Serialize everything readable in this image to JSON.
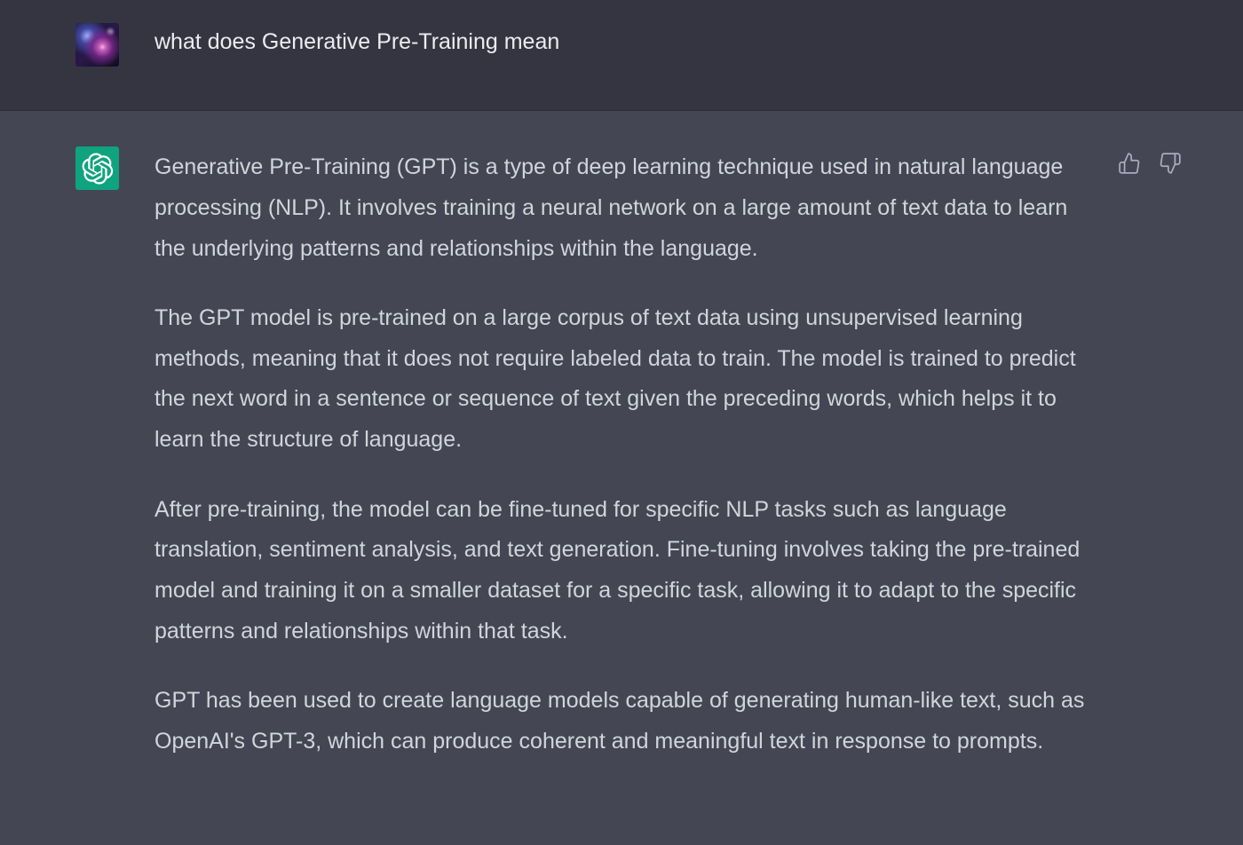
{
  "conversation": {
    "user_message": {
      "avatar": "user-avatar-image",
      "text": "what does Generative Pre-Training mean"
    },
    "assistant_message": {
      "avatar": "openai-logo-icon",
      "accent_color": "#10a37f",
      "paragraphs": [
        "Generative Pre-Training (GPT) is a type of deep learning technique used in natural language processing (NLP). It involves training a neural network on a large amount of text data to learn the underlying patterns and relationships within the language.",
        "The GPT model is pre-trained on a large corpus of text data using unsupervised learning methods, meaning that it does not require labeled data to train. The model is trained to predict the next word in a sentence or sequence of text given the preceding words, which helps it to learn the structure of language.",
        "After pre-training, the model can be fine-tuned for specific NLP tasks such as language translation, sentiment analysis, and text generation. Fine-tuning involves taking the pre-trained model and training it on a smaller dataset for a specific task, allowing it to adapt to the specific patterns and relationships within that task.",
        "GPT has been used to create language models capable of generating human-like text, such as OpenAI's GPT-3, which can produce coherent and meaningful text in response to prompts."
      ],
      "feedback_icons": [
        "thumbs-up-icon",
        "thumbs-down-icon"
      ]
    }
  },
  "colors": {
    "user_row_bg": "#343541",
    "assistant_row_bg": "#444654",
    "user_text": "#ececf1",
    "assistant_text": "#d1d5db",
    "icon": "#acacbe"
  }
}
